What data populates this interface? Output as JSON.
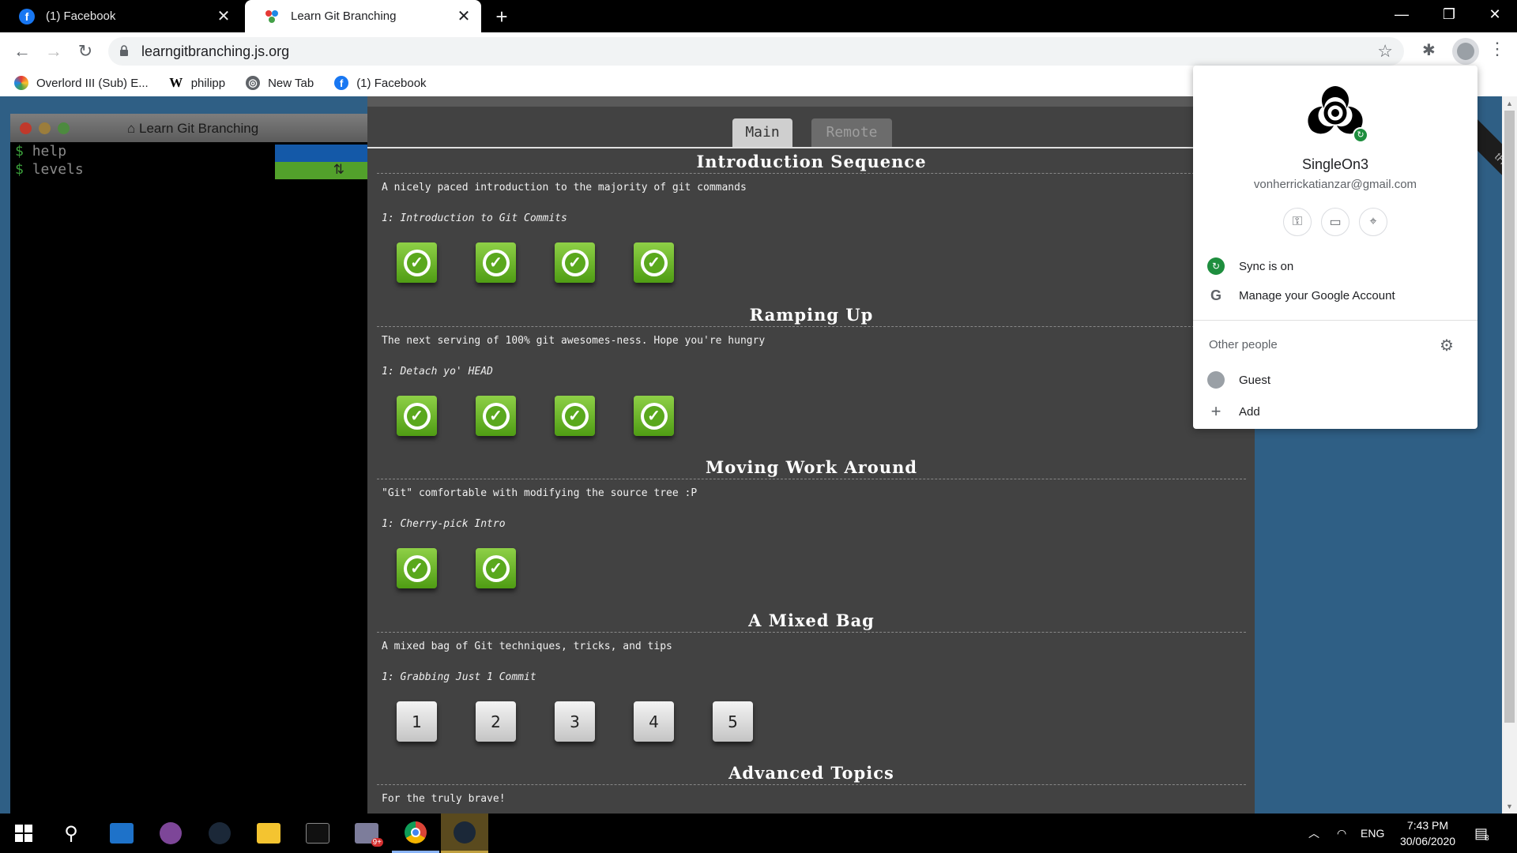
{
  "browser": {
    "tabs": [
      {
        "title": "(1) Facebook",
        "favicon": "facebook-icon"
      },
      {
        "title": "Learn Git Branching",
        "favicon": "learngitbranching-icon"
      }
    ],
    "url": "learngitbranching.js.org",
    "bookmarks": [
      {
        "label": "Overlord III (Sub) E...",
        "icon": "overlord-icon"
      },
      {
        "label": "philipp",
        "icon": "wikipedia-icon"
      },
      {
        "label": "New Tab",
        "icon": "globe-icon"
      },
      {
        "label": "(1) Facebook",
        "icon": "facebook-icon"
      }
    ]
  },
  "terminal": {
    "title": "Learn Git Branching",
    "lines": [
      "help",
      "levels"
    ],
    "prompt": "$"
  },
  "dialog": {
    "tabs": {
      "main": "Main",
      "remote": "Remote"
    },
    "sequences": [
      {
        "title": "Introduction Sequence",
        "description": "A nicely paced introduction to the majority of git commands",
        "current": "1: Introduction to Git Commits",
        "levels": [
          "done",
          "done",
          "done",
          "done"
        ]
      },
      {
        "title": "Ramping Up",
        "description": "The next serving of 100% git awesomes-ness. Hope you're hungry",
        "current": "1: Detach yo' HEAD",
        "levels": [
          "done",
          "done",
          "done",
          "done"
        ]
      },
      {
        "title": "Moving Work Around",
        "description": "\"Git\" comfortable with modifying the source tree :P",
        "current": "1: Cherry-pick Intro",
        "levels": [
          "done",
          "done"
        ]
      },
      {
        "title": "A Mixed Bag",
        "description": "A mixed bag of Git techniques, tricks, and tips",
        "current": "1: Grabbing Just 1 Commit",
        "levels": [
          "1",
          "2",
          "3",
          "4",
          "5"
        ]
      },
      {
        "title": "Advanced Topics",
        "description": "For the truly brave!"
      }
    ]
  },
  "profile_popup": {
    "name": "SingleOn3",
    "email": "vonherrickatianzar@gmail.com",
    "sync_label": "Sync is on",
    "manage_label": "Manage your Google Account",
    "other_people_label": "Other people",
    "guest_label": "Guest",
    "add_label": "Add"
  },
  "taskbar": {
    "time": "7:43 PM",
    "date": "30/06/2020",
    "language": "ENG",
    "notification_count": "8",
    "mail_badge": "9+"
  },
  "colors": {
    "page_background": "#2f5f85",
    "dialog_background": "#424242",
    "level_done_green": "#5aa81d",
    "sync_green": "#1e8e3e"
  }
}
